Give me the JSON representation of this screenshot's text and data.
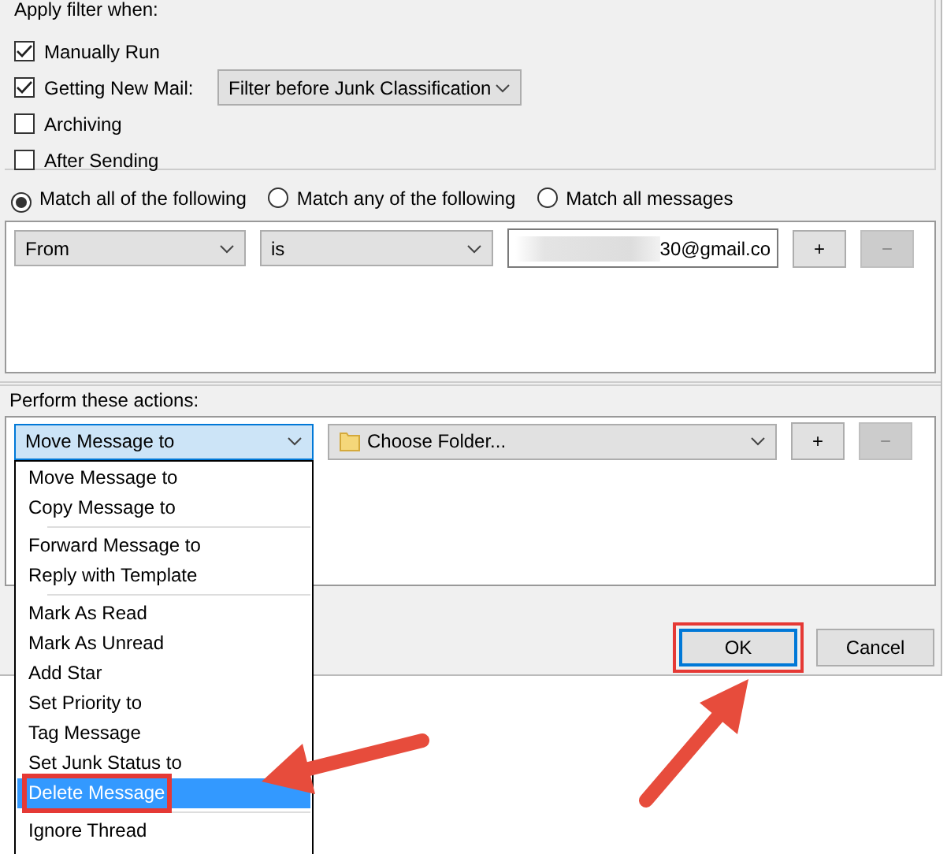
{
  "filter_when": {
    "label": "Apply filter when:",
    "options": [
      {
        "label": "Manually Run",
        "checked": true
      },
      {
        "label": "Getting New Mail:",
        "checked": true,
        "select": "Filter before Junk Classification"
      },
      {
        "label": "Archiving",
        "checked": false
      },
      {
        "label": "After Sending",
        "checked": false
      }
    ]
  },
  "match_mode": [
    {
      "label": "Match all of the following",
      "selected": true
    },
    {
      "label": "Match any of the following",
      "selected": false
    },
    {
      "label": "Match all messages",
      "selected": false
    }
  ],
  "conditions": [
    {
      "field": "From",
      "operator": "is",
      "value": "30@gmail.co",
      "add": "+",
      "remove": "−",
      "remove_disabled": true
    }
  ],
  "actions": {
    "label": "Perform these actions:",
    "rows": [
      {
        "action": "Move Message to",
        "target": "Choose Folder...",
        "add": "+",
        "remove": "−",
        "remove_disabled": true
      }
    ]
  },
  "action_menu": [
    [
      {
        "label": "Move Message to",
        "selected": false,
        "annotated": false
      },
      {
        "label": "Copy Message to",
        "selected": false,
        "annotated": false
      }
    ],
    [
      {
        "label": "Forward Message to",
        "selected": false,
        "annotated": false
      },
      {
        "label": "Reply with Template",
        "selected": false,
        "annotated": false
      }
    ],
    [
      {
        "label": "Mark As Read",
        "selected": false,
        "annotated": false
      },
      {
        "label": "Mark As Unread",
        "selected": false,
        "annotated": false
      },
      {
        "label": "Add Star",
        "selected": false,
        "annotated": false
      },
      {
        "label": "Set Priority to",
        "selected": false,
        "annotated": false
      },
      {
        "label": "Tag Message",
        "selected": false,
        "annotated": false
      },
      {
        "label": "Set Junk Status to",
        "selected": false,
        "annotated": false
      },
      {
        "label": "Delete Message",
        "selected": true,
        "annotated": true
      }
    ],
    [
      {
        "label": "Ignore Thread",
        "selected": false,
        "annotated": false
      }
    ]
  ],
  "buttons": [
    {
      "label": "OK",
      "default": true,
      "annotated": true
    },
    {
      "label": "Cancel",
      "default": false,
      "annotated": false
    }
  ]
}
